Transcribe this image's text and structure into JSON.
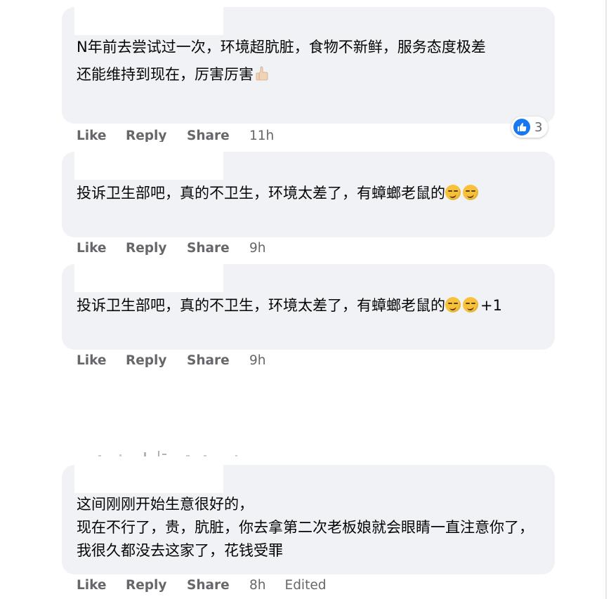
{
  "comments": [
    {
      "paragraphs": [
        "N年前去尝试过一次，环境超肮脏，食物不新鲜，服务态度极差",
        "还能维持到现在，厉害厉害"
      ],
      "emoji": "thumbs-up-icon",
      "actions": {
        "like": "Like",
        "reply": "Reply",
        "share": "Share",
        "time": "11h"
      },
      "reaction": {
        "icon": "like-reaction-icon",
        "count": "3"
      }
    },
    {
      "paragraphs": [
        "投诉卫生部吧，真的不卫生，环境太差了，有蟑螂老鼠的"
      ],
      "suffix": "",
      "emoji": "smirk-face-icon",
      "actions": {
        "like": "Like",
        "reply": "Reply",
        "share": "Share",
        "time": "9h"
      }
    },
    {
      "paragraphs": [
        "投诉卫生部吧，真的不卫生，环境太差了，有蟑螂老鼠的"
      ],
      "suffix": "+1",
      "emoji": "smirk-face-icon",
      "actions": {
        "like": "Like",
        "reply": "Reply",
        "share": "Share",
        "time": "9h"
      }
    },
    {
      "paragraphs": [
        "这间刚刚开始生意很好的，",
        "现在不行了，贵，肮脏，你去拿第二次老板娘就会眼睛一直注意你了，我很久都没去这家了，花钱受罪"
      ],
      "actions": {
        "like": "Like",
        "reply": "Reply",
        "share": "Share",
        "time": "8h",
        "edited": "Edited"
      }
    }
  ],
  "colors": {
    "bubble": "#f0f2f5",
    "meta_text": "#65676b",
    "like_blue": "#1877f2"
  }
}
